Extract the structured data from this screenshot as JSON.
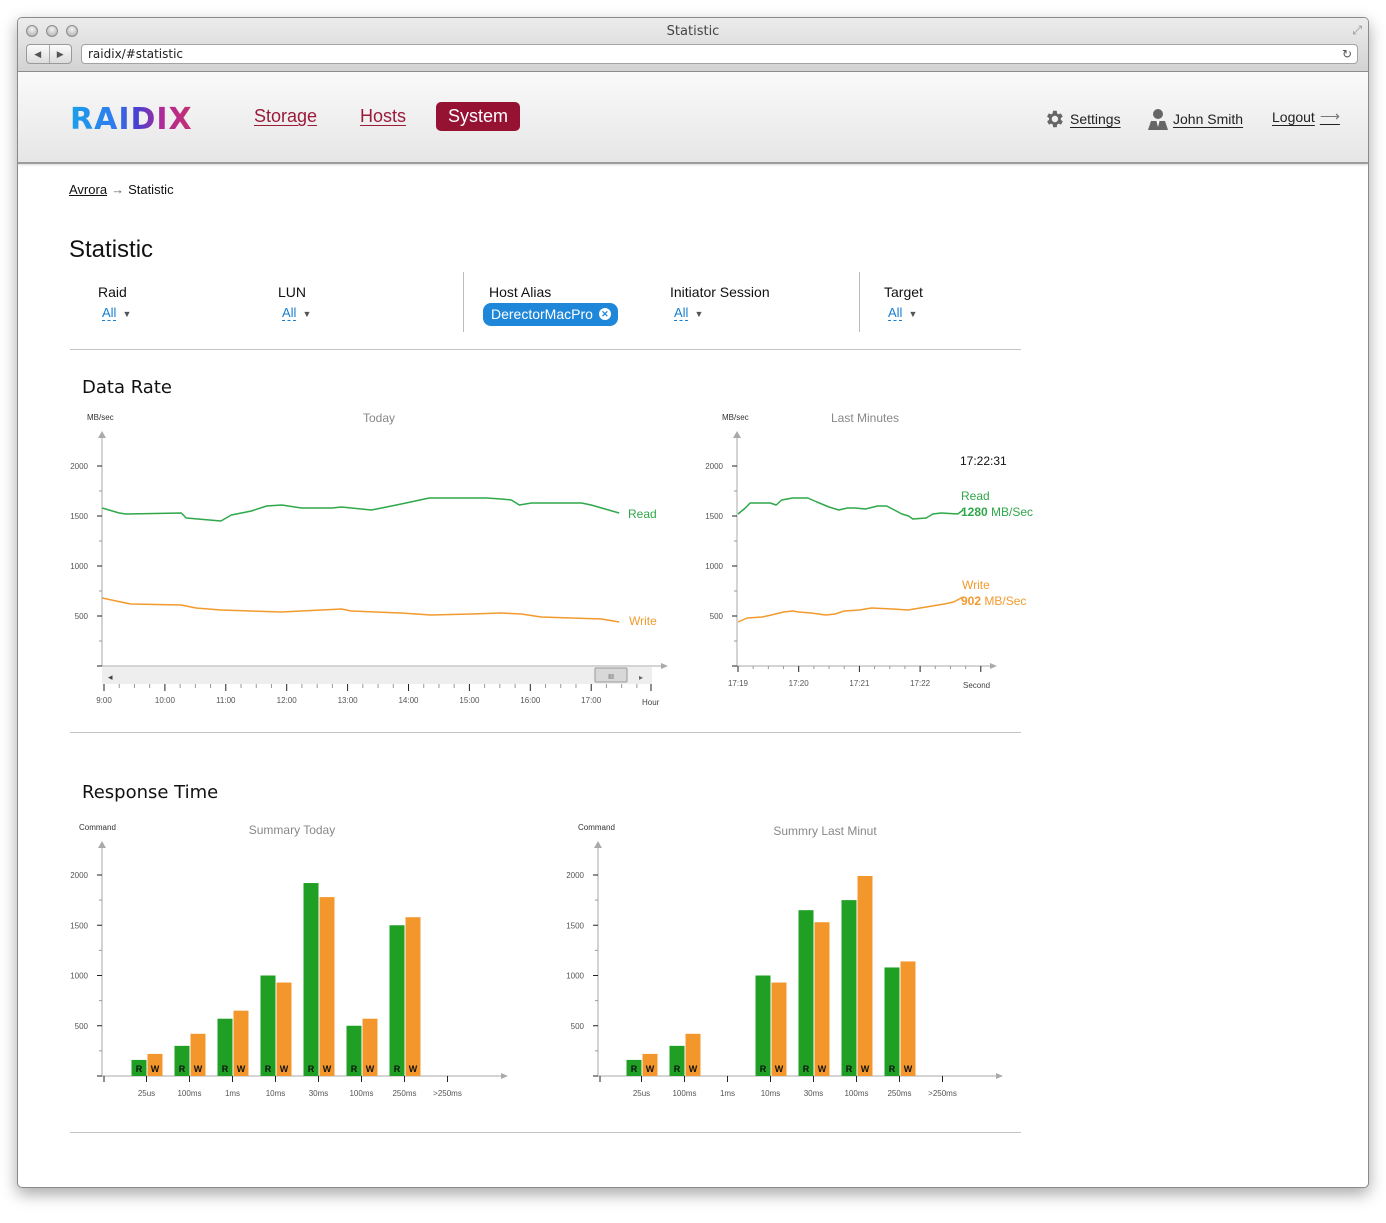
{
  "browser": {
    "window_title": "Statistic",
    "url": "raidix/#statistic",
    "back_icon": "back-arrow-icon",
    "forward_icon": "forward-arrow-icon",
    "reload_icon": "reload-icon"
  },
  "header": {
    "logo": "RAIDIX",
    "nav": [
      {
        "label": "Storage",
        "active": false
      },
      {
        "label": "Hosts",
        "active": false
      },
      {
        "label": "System",
        "active": true
      }
    ],
    "settings_label": "Settings",
    "user_label": "John Smith",
    "logout_label": "Logout",
    "logout_arrow": "⟶",
    "colors": {
      "brand": "#961233",
      "active_nav_text": "#ffffff"
    }
  },
  "breadcrumb": {
    "parent": "Avrora",
    "separator": "→",
    "current": "Statistic"
  },
  "page": {
    "title": "Statistic"
  },
  "filters": {
    "raid": {
      "label": "Raid",
      "value": "All"
    },
    "lun": {
      "label": "LUN",
      "value": "All"
    },
    "host_alias": {
      "label": "Host Alias",
      "chip": "DerectorMacPro"
    },
    "initiator_session": {
      "label": "Initiator Session",
      "value": "All"
    },
    "target": {
      "label": "Target",
      "value": "All"
    },
    "link_color": "#1a7fd0",
    "chip_color": "#1f87d9"
  },
  "sections": {
    "data_rate": "Data Rate",
    "response_time": "Response Time"
  },
  "chart_data": [
    {
      "id": "today",
      "type": "line",
      "title": "Today",
      "ylabel": "MB/sec",
      "xlabel": "Hour",
      "ylim": [
        0,
        2200
      ],
      "yticks": [
        500,
        1000,
        1500,
        2000
      ],
      "xticks": [
        "9:00",
        "10:00",
        "11:00",
        "12:00",
        "13:00",
        "14:00",
        "15:00",
        "16:00",
        "17:00"
      ],
      "xlim_hours": [
        9.0,
        17.95
      ],
      "grid": false,
      "has_scrollbar": true,
      "series": [
        {
          "name": "Read",
          "color": "#2ea84a",
          "points": [
            [
              8.97,
              1580
            ],
            [
              9.25,
              1530
            ],
            [
              9.36,
              1520
            ],
            [
              10.27,
              1530
            ],
            [
              10.35,
              1480
            ],
            [
              10.92,
              1450
            ],
            [
              11.09,
              1510
            ],
            [
              11.42,
              1550
            ],
            [
              11.67,
              1600
            ],
            [
              11.92,
              1610
            ],
            [
              12.24,
              1580
            ],
            [
              12.74,
              1580
            ],
            [
              12.9,
              1590
            ],
            [
              13.39,
              1560
            ],
            [
              13.56,
              1580
            ],
            [
              13.88,
              1620
            ],
            [
              14.34,
              1680
            ],
            [
              15.28,
              1680
            ],
            [
              15.52,
              1670
            ],
            [
              15.69,
              1660
            ],
            [
              15.82,
              1610
            ],
            [
              16.02,
              1630
            ],
            [
              16.84,
              1630
            ],
            [
              17.0,
              1610
            ],
            [
              17.17,
              1580
            ],
            [
              17.46,
              1530
            ]
          ]
        },
        {
          "name": "Write",
          "color": "#f39a2e",
          "points": [
            [
              8.97,
              680
            ],
            [
              9.2,
              650
            ],
            [
              9.44,
              620
            ],
            [
              10.27,
              610
            ],
            [
              10.51,
              580
            ],
            [
              10.92,
              560
            ],
            [
              11.91,
              540
            ],
            [
              12.9,
              570
            ],
            [
              13.06,
              550
            ],
            [
              13.88,
              530
            ],
            [
              14.37,
              510
            ],
            [
              15.03,
              520
            ],
            [
              15.52,
              530
            ],
            [
              15.85,
              520
            ],
            [
              16.18,
              490
            ],
            [
              17.17,
              470
            ],
            [
              17.46,
              440
            ]
          ]
        }
      ]
    },
    {
      "id": "last_minutes",
      "type": "line",
      "title": "Last Minutes",
      "ylabel": "MB/sec",
      "xlabel": "Second",
      "ylim": [
        0,
        2200
      ],
      "yticks": [
        500,
        1000,
        1500,
        2000
      ],
      "xticks": [
        "17:19",
        "17:20",
        "17:21",
        "17:22"
      ],
      "xlim_minutes": [
        0,
        4.1
      ],
      "grid": false,
      "timestamp": "17:22:31",
      "series": [
        {
          "name": "Read",
          "color": "#2ea84a",
          "current_value": "1280",
          "unit": "MB/Sec",
          "points": [
            [
              0,
              1520
            ],
            [
              0.12,
              1580
            ],
            [
              0.2,
              1630
            ],
            [
              0.53,
              1630
            ],
            [
              0.63,
              1610
            ],
            [
              0.72,
              1660
            ],
            [
              0.9,
              1680
            ],
            [
              1.15,
              1680
            ],
            [
              1.3,
              1640
            ],
            [
              1.5,
              1590
            ],
            [
              1.66,
              1560
            ],
            [
              1.8,
              1580
            ],
            [
              1.93,
              1580
            ],
            [
              2.1,
              1570
            ],
            [
              2.3,
              1600
            ],
            [
              2.45,
              1600
            ],
            [
              2.7,
              1520
            ],
            [
              2.81,
              1500
            ],
            [
              2.88,
              1470
            ],
            [
              3.1,
              1480
            ],
            [
              3.21,
              1520
            ],
            [
              3.35,
              1530
            ],
            [
              3.62,
              1520
            ],
            [
              3.71,
              1560
            ]
          ]
        },
        {
          "name": "Write",
          "color": "#f39a2e",
          "current_value": "902",
          "unit": "MB/Sec",
          "points": [
            [
              0,
              440
            ],
            [
              0.15,
              480
            ],
            [
              0.4,
              490
            ],
            [
              0.55,
              510
            ],
            [
              0.75,
              540
            ],
            [
              0.9,
              550
            ],
            [
              1.0,
              540
            ],
            [
              1.2,
              530
            ],
            [
              1.45,
              510
            ],
            [
              1.6,
              520
            ],
            [
              1.75,
              550
            ],
            [
              2.0,
              560
            ],
            [
              2.2,
              580
            ],
            [
              2.55,
              570
            ],
            [
              2.8,
              560
            ],
            [
              3.0,
              580
            ],
            [
              3.2,
              600
            ],
            [
              3.4,
              620
            ],
            [
              3.55,
              640
            ],
            [
              3.71,
              690
            ]
          ]
        }
      ]
    },
    {
      "id": "summary_today",
      "type": "bar",
      "title": "Summary Today",
      "ylabel": "Command",
      "ylim": [
        0,
        2200
      ],
      "yticks": [
        500,
        1000,
        1500,
        2000
      ],
      "categories": [
        "25us",
        "100ms",
        "1ms",
        "10ms",
        "30ms",
        "100ms",
        "250ms",
        ">250ms"
      ],
      "bar_labels": {
        "read": "R",
        "write": "W"
      },
      "series": [
        {
          "name": "Read",
          "color": "#1fa024",
          "values": [
            160,
            300,
            570,
            1000,
            1920,
            500,
            1500,
            0
          ]
        },
        {
          "name": "Write",
          "color": "#f3972c",
          "values": [
            220,
            420,
            650,
            930,
            1780,
            570,
            1580,
            0
          ]
        }
      ]
    },
    {
      "id": "summary_last_minute",
      "type": "bar",
      "title": "Summry Last Minut",
      "ylabel": "Command",
      "ylim": [
        0,
        2200
      ],
      "yticks": [
        500,
        1000,
        1500,
        2000
      ],
      "categories": [
        "25us",
        "100ms",
        "1ms",
        "10ms",
        "30ms",
        "100ms",
        "250ms",
        ">250ms"
      ],
      "bar_labels": {
        "read": "R",
        "write": "W"
      },
      "series": [
        {
          "name": "Read",
          "color": "#1fa024",
          "values": [
            160,
            300,
            0,
            1000,
            1650,
            1750,
            1080,
            0
          ]
        },
        {
          "name": "Write",
          "color": "#f3972c",
          "values": [
            220,
            420,
            0,
            930,
            1530,
            1990,
            1140,
            0
          ]
        }
      ]
    }
  ]
}
